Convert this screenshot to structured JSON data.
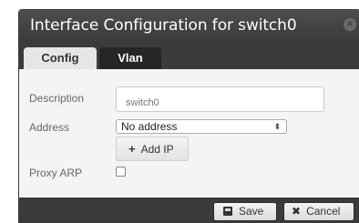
{
  "dialog": {
    "title": "Interface Configuration for switch0",
    "close_icon": "close-icon"
  },
  "tabs": [
    {
      "label": "Config",
      "active": true
    },
    {
      "label": "Vlan",
      "active": false
    }
  ],
  "form": {
    "description_label": "Description",
    "description_placeholder": "switch0",
    "address_label": "Address",
    "address_value": "No address",
    "add_ip_label": "Add IP",
    "add_ip_icon": "plus-icon",
    "proxy_arp_label": "Proxy ARP",
    "proxy_arp_checked": false
  },
  "footer": {
    "save_label": "Save",
    "save_icon": "floppy-disk-icon",
    "cancel_label": "Cancel",
    "cancel_icon": "x-icon"
  },
  "colors": {
    "titlebar": "#3b3b3b",
    "panel": "#f4f4f4",
    "active_tab": "#e6e6e6"
  }
}
